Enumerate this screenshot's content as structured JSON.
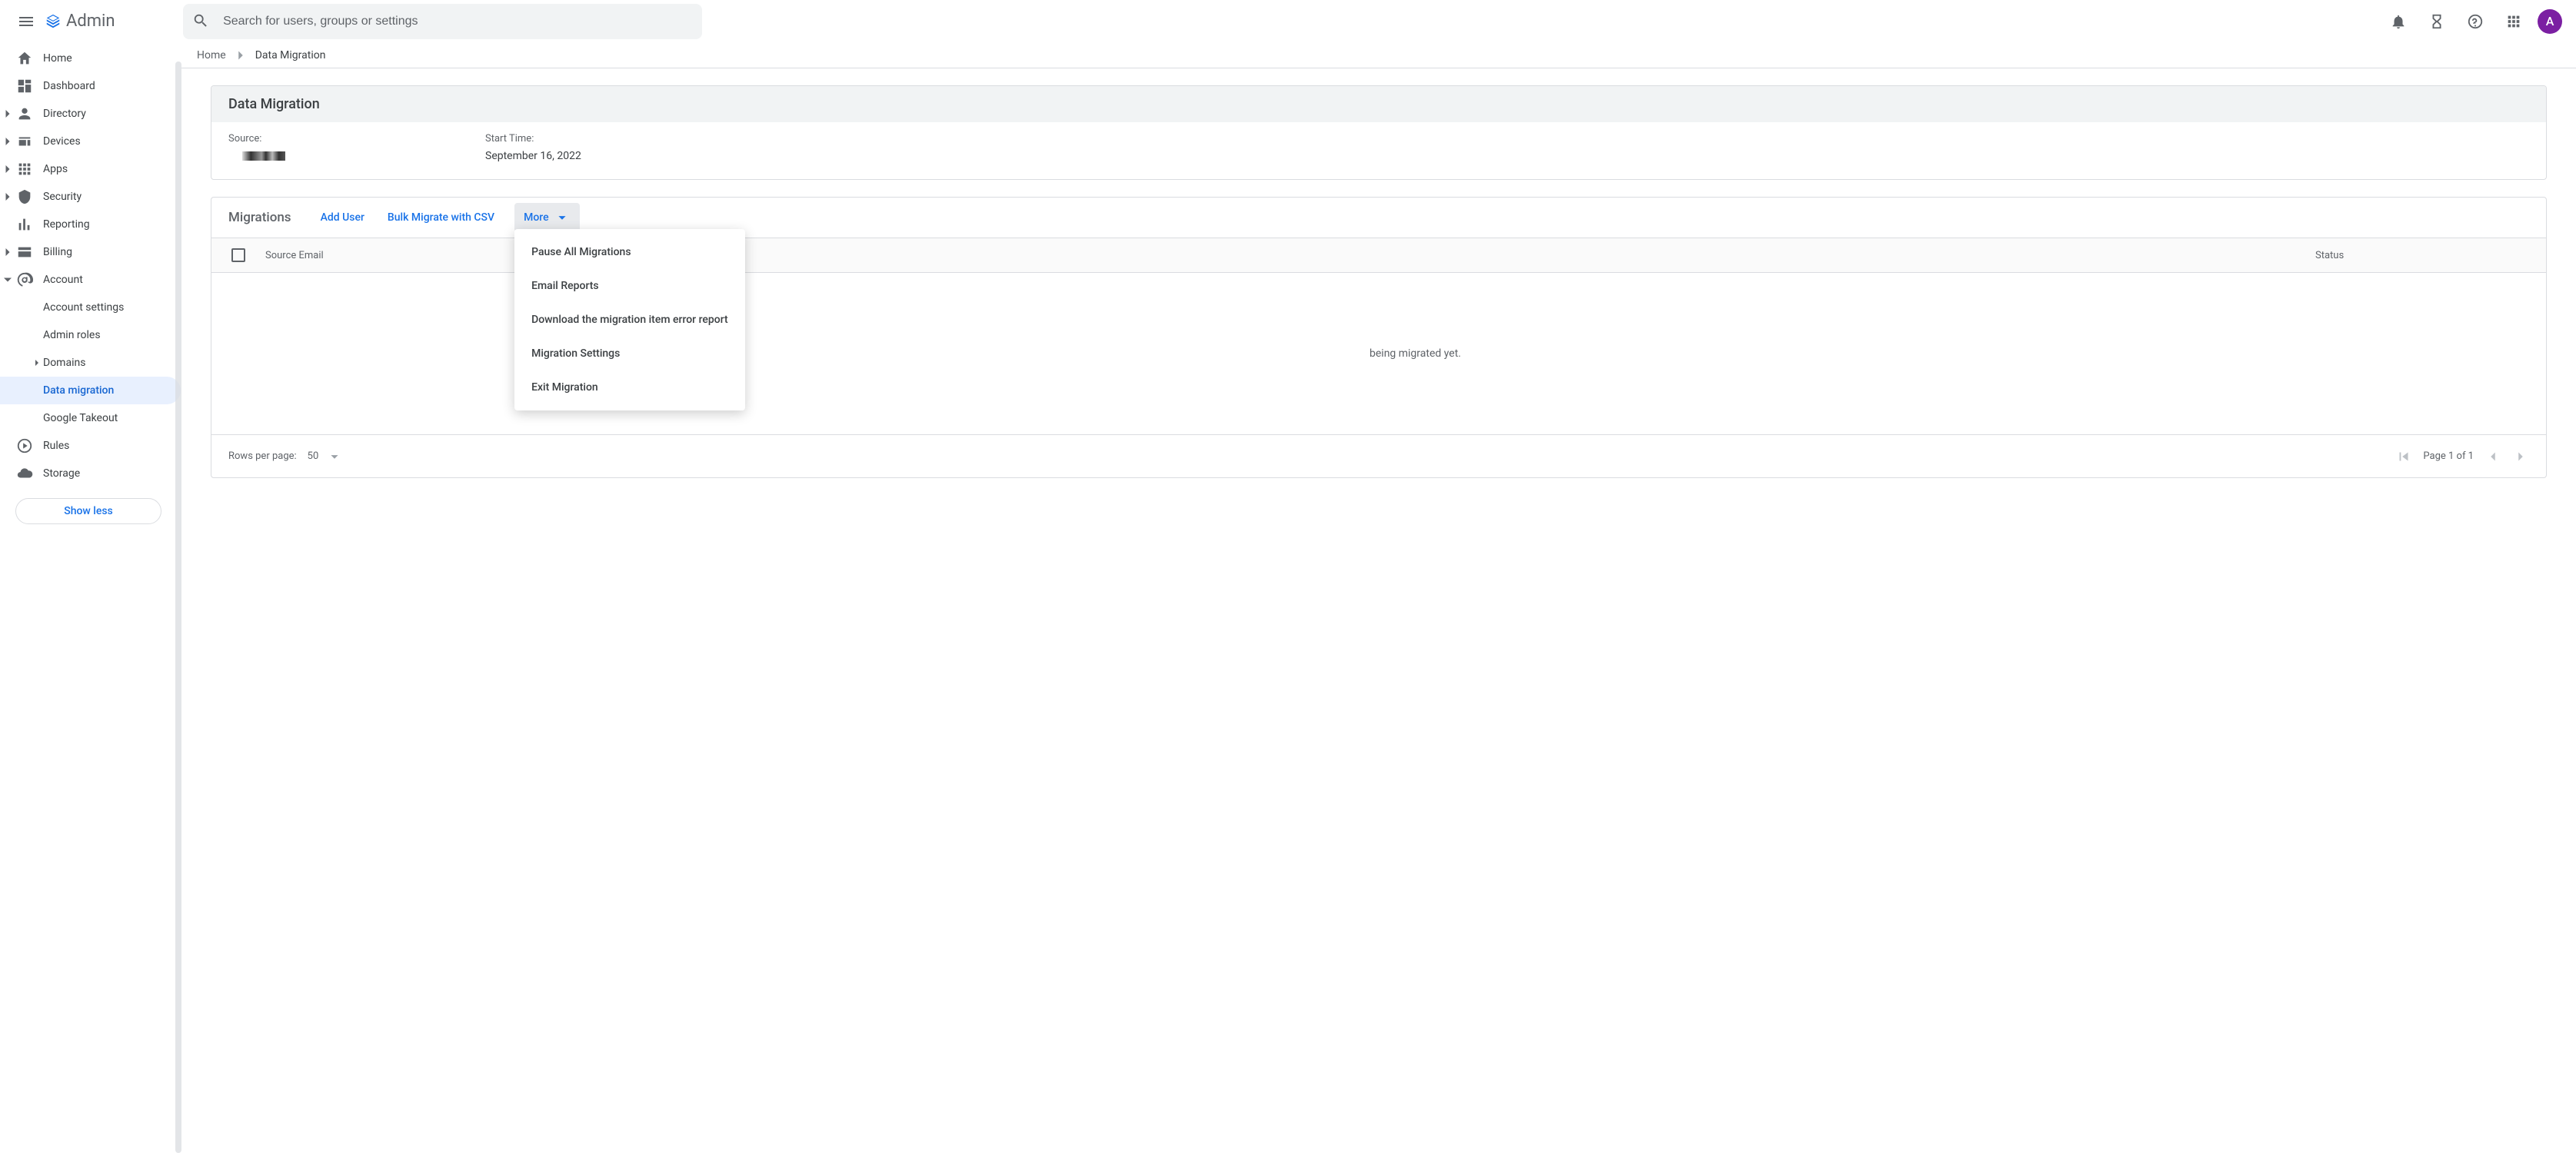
{
  "app": {
    "name": "Admin"
  },
  "search": {
    "placeholder": "Search for users, groups or settings"
  },
  "avatar": {
    "initial": "A"
  },
  "sidebar": {
    "home": "Home",
    "dashboard": "Dashboard",
    "directory": "Directory",
    "devices": "Devices",
    "apps": "Apps",
    "security": "Security",
    "reporting": "Reporting",
    "billing": "Billing",
    "account": "Account",
    "account_children": {
      "account_settings": "Account settings",
      "admin_roles": "Admin roles",
      "domains": "Domains",
      "data_migration": "Data migration",
      "google_takeout": "Google Takeout"
    },
    "rules": "Rules",
    "storage": "Storage",
    "show_less": "Show less"
  },
  "breadcrumbs": {
    "home": "Home",
    "current": "Data Migration"
  },
  "migration_card": {
    "title": "Data Migration",
    "source_label": "Source:",
    "start_time_label": "Start Time:",
    "start_time_value": "September 16, 2022"
  },
  "migrations": {
    "title": "Migrations",
    "add_user": "Add User",
    "bulk": "Bulk Migrate with CSV",
    "more": "More",
    "more_menu": {
      "pause": "Pause All Migrations",
      "email_reports": "Email Reports",
      "download_error": "Download the migration item error report",
      "settings": "Migration Settings",
      "exit": "Exit Migration"
    },
    "columns": {
      "source_email": "Source Email",
      "status": "Status"
    },
    "empty_message_suffix": " being migrated yet.",
    "footer": {
      "rows_label": "Rows per page:",
      "rows_value": "50",
      "page_text": "Page 1 of 1"
    }
  }
}
